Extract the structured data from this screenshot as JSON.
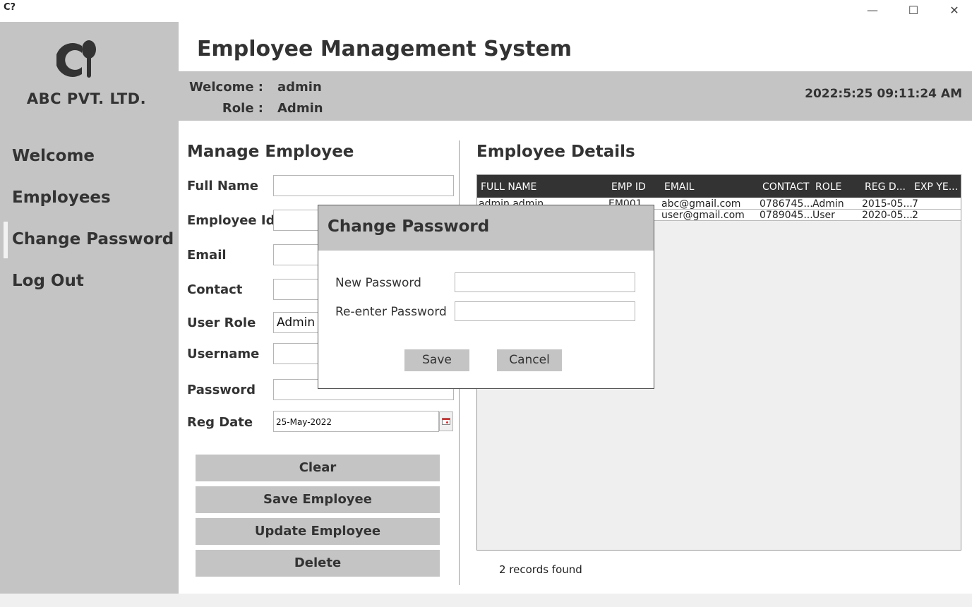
{
  "window": {
    "app_icon": "C?",
    "minimize_glyph": "—",
    "maximize_glyph": "☐",
    "close_glyph": "✕"
  },
  "sidebar": {
    "company": "ABC PVT. LTD.",
    "items": [
      {
        "label": "Welcome"
      },
      {
        "label": "Employees"
      },
      {
        "label": "Change Password",
        "active": true
      },
      {
        "label": "Log Out"
      }
    ]
  },
  "header": {
    "title": "Employee Management System",
    "welcome_label": "Welcome :",
    "welcome_value": "admin",
    "role_label": "Role :",
    "role_value": "Admin",
    "datetime": "2022:5:25  09:11:24 AM"
  },
  "form": {
    "title": "Manage Employee",
    "fields": {
      "full_name": {
        "label": "Full Name",
        "value": ""
      },
      "employee_id": {
        "label": "Employee Id",
        "value": ""
      },
      "email": {
        "label": "Email",
        "value": ""
      },
      "contact": {
        "label": "Contact",
        "value": ""
      },
      "user_role": {
        "label": "User Role",
        "value": "Admin"
      },
      "username": {
        "label": "Username",
        "value": ""
      },
      "password": {
        "label": "Password",
        "value": ""
      },
      "reg_date": {
        "label": "Reg Date",
        "value": "25-May-2022"
      }
    },
    "buttons": {
      "clear": "Clear",
      "save": "Save Employee",
      "update": "Update Employee",
      "delete": "Delete"
    }
  },
  "details": {
    "title": "Employee Details",
    "columns": [
      "FULL NAME",
      "EMP ID",
      "EMAIL",
      "CONTACT",
      "ROLE",
      "REG D...",
      "EXP YE..."
    ],
    "rows": [
      [
        "admin admin",
        "EM001",
        "abc@gmail.com",
        "0786745...",
        "Admin",
        "2015-05...",
        "7"
      ],
      [
        "",
        "",
        "user@gmail.com",
        "0789045...",
        "User",
        "2020-05...",
        "2"
      ]
    ],
    "records_text": "2  records found"
  },
  "dialog": {
    "title": "Change Password",
    "new_password_label": "New Password",
    "reenter_password_label": "Re-enter Password",
    "save_label": "Save",
    "cancel_label": "Cancel"
  },
  "colors": {
    "panel_gray": "#c4c4c4",
    "table_header": "#333333",
    "text_dark": "#333333"
  }
}
